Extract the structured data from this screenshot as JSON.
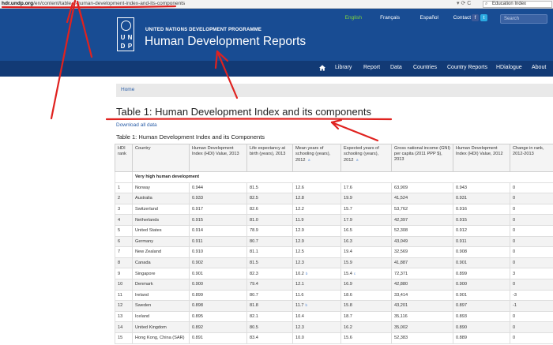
{
  "browser": {
    "url_host": "hdr.undp.org",
    "url_path": "/en/content/table-1-human-development-index-and-its-components",
    "controls": "▾ ⟳ C",
    "search_value": "Education Index"
  },
  "header": {
    "languages": [
      "English",
      "Français",
      "Español"
    ],
    "contact": "Contact",
    "search_placeholder": "Search",
    "logo_letters": [
      "U",
      "N",
      "D",
      "P"
    ],
    "programme": "UNITED NATIONS DEVELOPMENT PROGRAMME",
    "site_title": "Human Development Reports",
    "active_color": "#7fd33f"
  },
  "nav": {
    "items": [
      "Library",
      "Report",
      "Data",
      "Countries",
      "Country Reports",
      "HDialogue",
      "About"
    ]
  },
  "breadcrumb": {
    "home": "Home"
  },
  "page": {
    "title": "Table 1: Human Development Index and its components",
    "download": "Download all data",
    "caption": "Table 1: Human Development Index and its Components"
  },
  "table": {
    "headers": [
      "HDI rank",
      "Country",
      "Human Development Index (HDI) Value, 2013",
      "Life expectancy at birth (years), 2013",
      "Mean years of schooling (years), 2012",
      "Expected years of schooling (years), 2012",
      "Gross national income (GNI) per capita (2011 PPP $), 2013",
      "Human Development Index (HDI) Value, 2012",
      "Change in rank, 2012-2013"
    ],
    "header_notes": {
      "mean": "a",
      "expected": "a"
    },
    "group_label": "Very high human development",
    "rows": [
      {
        "rank": "1",
        "country": "Norway",
        "hdi2013": "0.944",
        "life": "81.5",
        "mean": "12.6",
        "mean_note": "",
        "expected": "17.6",
        "expected_note": "",
        "gni": "63,909",
        "hdi2012": "0.943",
        "change": "0"
      },
      {
        "rank": "2",
        "country": "Australia",
        "hdi2013": "0.933",
        "life": "82.5",
        "mean": "12.8",
        "mean_note": "",
        "expected": "19.9",
        "expected_note": "",
        "gni": "41,524",
        "hdi2012": "0.931",
        "change": "0"
      },
      {
        "rank": "3",
        "country": "Switzerland",
        "hdi2013": "0.917",
        "life": "82.6",
        "mean": "12.2",
        "mean_note": "",
        "expected": "15.7",
        "expected_note": "",
        "gni": "53,762",
        "hdi2012": "0.916",
        "change": "0"
      },
      {
        "rank": "4",
        "country": "Netherlands",
        "hdi2013": "0.915",
        "life": "81.0",
        "mean": "11.9",
        "mean_note": "",
        "expected": "17.9",
        "expected_note": "",
        "gni": "42,397",
        "hdi2012": "0.915",
        "change": "0"
      },
      {
        "rank": "5",
        "country": "United States",
        "hdi2013": "0.914",
        "life": "78.9",
        "mean": "12.9",
        "mean_note": "",
        "expected": "16.5",
        "expected_note": "",
        "gni": "52,308",
        "hdi2012": "0.912",
        "change": "0"
      },
      {
        "rank": "6",
        "country": "Germany",
        "hdi2013": "0.911",
        "life": "80.7",
        "mean": "12.9",
        "mean_note": "",
        "expected": "16.3",
        "expected_note": "",
        "gni": "43,049",
        "hdi2012": "0.911",
        "change": "0"
      },
      {
        "rank": "7",
        "country": "New Zealand",
        "hdi2013": "0.910",
        "life": "81.1",
        "mean": "12.5",
        "mean_note": "",
        "expected": "19.4",
        "expected_note": "",
        "gni": "32,569",
        "hdi2012": "0.908",
        "change": "0"
      },
      {
        "rank": "8",
        "country": "Canada",
        "hdi2013": "0.902",
        "life": "81.5",
        "mean": "12.3",
        "mean_note": "",
        "expected": "15.9",
        "expected_note": "",
        "gni": "41,887",
        "hdi2012": "0.901",
        "change": "0"
      },
      {
        "rank": "9",
        "country": "Singapore",
        "hdi2013": "0.901",
        "life": "82.3",
        "mean": "10.2",
        "mean_note": "b",
        "expected": "15.4",
        "expected_note": "c",
        "gni": "72,371",
        "hdi2012": "0.899",
        "change": "3"
      },
      {
        "rank": "10",
        "country": "Denmark",
        "hdi2013": "0.900",
        "life": "79.4",
        "mean": "12.1",
        "mean_note": "",
        "expected": "16.9",
        "expected_note": "",
        "gni": "42,880",
        "hdi2012": "0.900",
        "change": "0"
      },
      {
        "rank": "11",
        "country": "Ireland",
        "hdi2013": "0.899",
        "life": "80.7",
        "mean": "11.6",
        "mean_note": "",
        "expected": "18.6",
        "expected_note": "",
        "gni": "33,414",
        "hdi2012": "0.901",
        "change": "-3"
      },
      {
        "rank": "12",
        "country": "Sweden",
        "hdi2013": "0.898",
        "life": "81.8",
        "mean": "11.7",
        "mean_note": "b",
        "expected": "15.8",
        "expected_note": "",
        "gni": "43,201",
        "hdi2012": "0.897",
        "change": "-1"
      },
      {
        "rank": "13",
        "country": "Iceland",
        "hdi2013": "0.895",
        "life": "82.1",
        "mean": "10.4",
        "mean_note": "",
        "expected": "18.7",
        "expected_note": "",
        "gni": "35,116",
        "hdi2012": "0.893",
        "change": "0"
      },
      {
        "rank": "14",
        "country": "United Kingdom",
        "hdi2013": "0.892",
        "life": "80.5",
        "mean": "12.3",
        "mean_note": "",
        "expected": "16.2",
        "expected_note": "",
        "gni": "35,002",
        "hdi2012": "0.890",
        "change": "0"
      },
      {
        "rank": "15",
        "country": "Hong Kong, China (SAR)",
        "hdi2013": "0.891",
        "life": "83.4",
        "mean": "10.0",
        "mean_note": "",
        "expected": "15.6",
        "expected_note": "",
        "gni": "52,383",
        "hdi2012": "0.889",
        "change": "0"
      }
    ]
  },
  "annotation_color": "#e0221f"
}
